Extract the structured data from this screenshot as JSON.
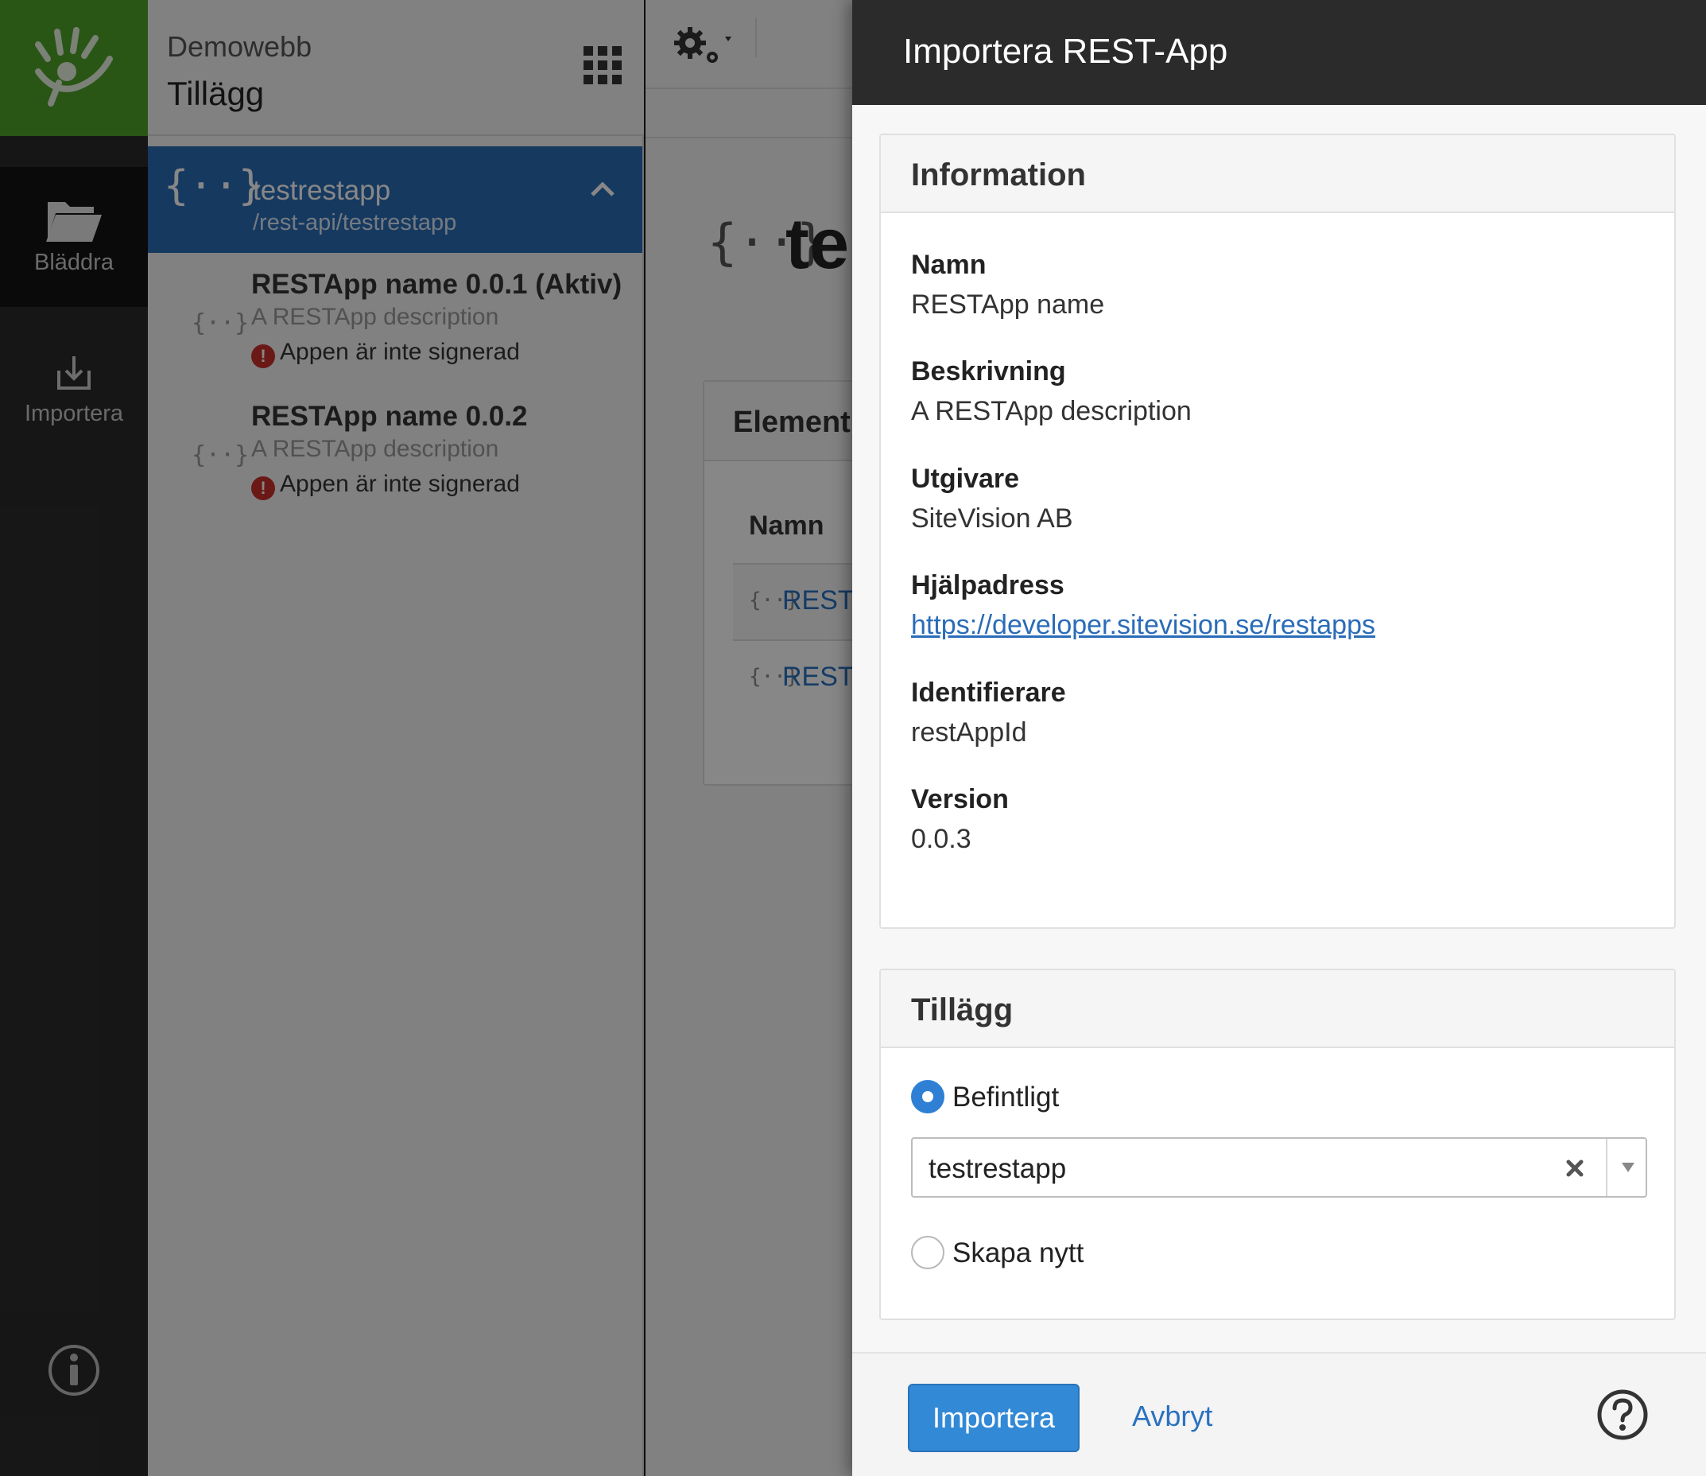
{
  "app": {
    "site_name": "Demowebb",
    "page_name": "Tillägg",
    "nav": {
      "browse_label": "Bläddra",
      "import_label": "Importera"
    }
  },
  "addon_list": {
    "selected": {
      "icon": "{··}",
      "title": "testrestapp",
      "path": "/rest-api/testrestapp"
    },
    "versions": [
      {
        "icon": "{··}",
        "title": "RESTApp name 0.0.1 (Aktiv)",
        "description": "A RESTApp description",
        "warning": "Appen är inte signerad"
      },
      {
        "icon": "{··}",
        "title": "RESTApp name 0.0.2",
        "description": "A RESTApp description",
        "warning": "Appen är inte signerad"
      }
    ]
  },
  "content": {
    "title_icon": "{··}",
    "title": "te",
    "elements_panel": {
      "title": "Element",
      "column": "Namn",
      "rows": [
        {
          "icon": "{··}",
          "text": "REST"
        },
        {
          "icon": "{··}",
          "text": "REST"
        }
      ]
    }
  },
  "dialog": {
    "title": "Importera REST-App",
    "info_panel": {
      "title": "Information",
      "fields": [
        {
          "label": "Namn",
          "value": "RESTApp name"
        },
        {
          "label": "Beskrivning",
          "value": "A RESTApp description"
        },
        {
          "label": "Utgivare",
          "value": "SiteVision AB"
        },
        {
          "label": "Hjälpadress",
          "value": "https://developer.sitevision.se/restapps"
        },
        {
          "label": "Identifierare",
          "value": "restAppId"
        },
        {
          "label": "Version",
          "value": "0.0.3"
        }
      ]
    },
    "addon_panel": {
      "title": "Tillägg",
      "option_existing": "Befintligt",
      "selected_value": "testrestapp",
      "option_new": "Skapa nytt"
    },
    "footer": {
      "import_label": "Importera",
      "cancel_label": "Avbryt"
    }
  },
  "colors": {
    "brand_green": "#4ea229",
    "selected_blue": "#2b6cb5",
    "primary_button": "#3289d6",
    "link": "#2a72c0",
    "warning_red": "#c9302c"
  }
}
